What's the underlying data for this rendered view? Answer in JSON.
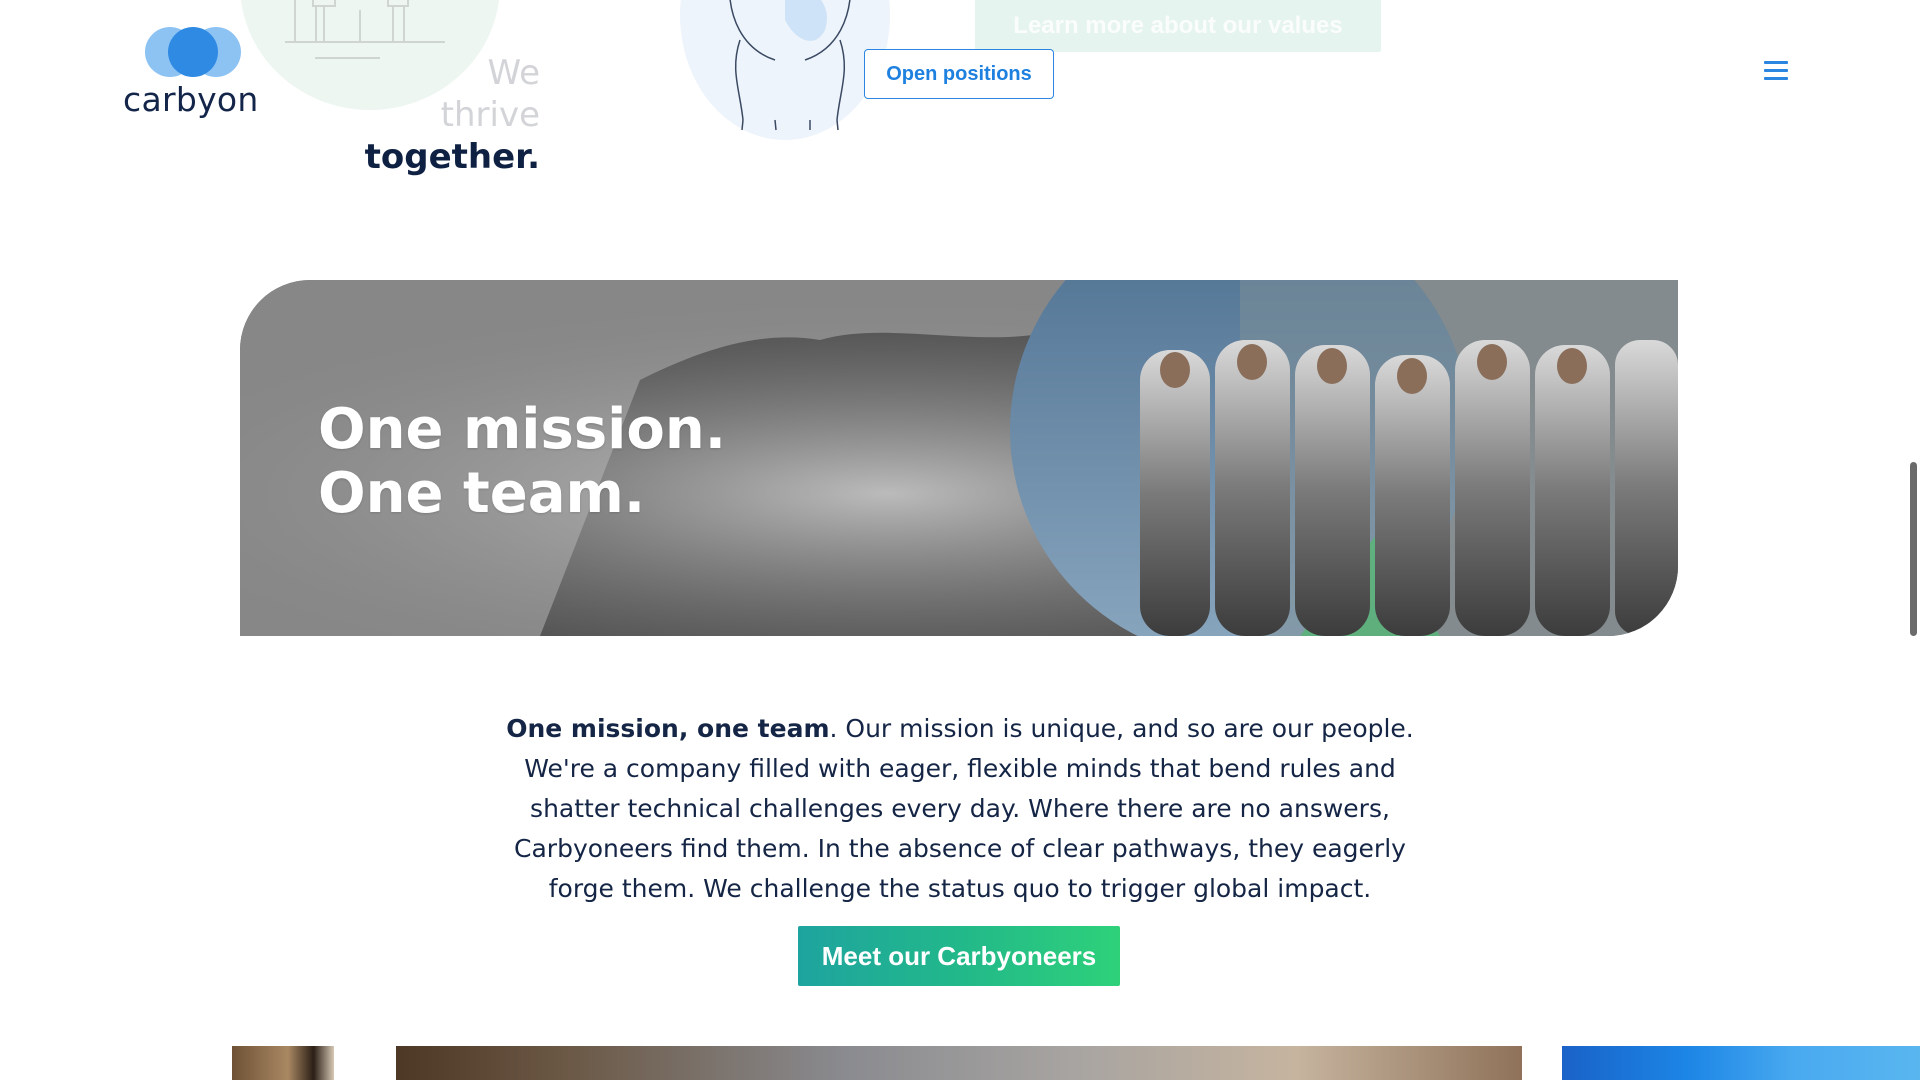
{
  "brand": {
    "name": "carbyon",
    "logo_icon": "carbyon-logo-icon",
    "colors": {
      "navy": "#14254a",
      "blue": "#2b86e1",
      "teal": "#1ea49f",
      "green": "#2ed17a"
    }
  },
  "header": {
    "thrive_line1": "We",
    "thrive_line2": "thrive",
    "thrive_line3": "together.",
    "values_button": "Learn more about our values",
    "open_positions_button": "Open positions",
    "menu_icon": "hamburger-menu-icon"
  },
  "hero": {
    "title_line1": "One mission.",
    "title_line2": "One team."
  },
  "mission": {
    "lead_bold": "One mission, one team",
    "body": ". Our mission is unique, and so are our people. We're a company filled with eager, flexible minds that bend rules and shatter technical challenges every day. Where there are no answers, Carbyoneers find them. In the absence of clear pathways, they eagerly forge them. We challenge the status quo to trigger global impact.",
    "cta": "Meet our Carbyoneers"
  }
}
